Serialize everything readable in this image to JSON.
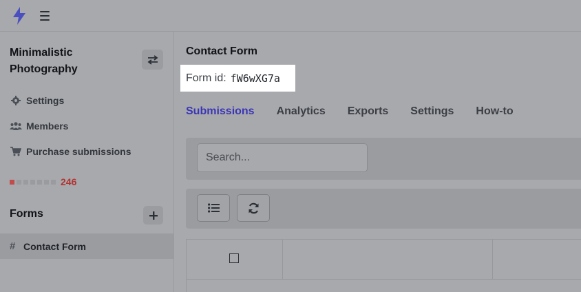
{
  "sidebar": {
    "project_name": "Minimalistic Photography",
    "nav": [
      {
        "label": "Settings",
        "icon": "gear-icon"
      },
      {
        "label": "Members",
        "icon": "users-icon"
      },
      {
        "label": "Purchase submissions",
        "icon": "cart-icon"
      }
    ],
    "usage": {
      "count": "246",
      "filled_segments": 1,
      "total_segments": 7
    },
    "forms_heading": "Forms",
    "forms": [
      {
        "label": "Contact Form",
        "icon": "hash-icon"
      }
    ]
  },
  "main": {
    "title": "Contact Form",
    "form_id_label": "Form id:",
    "form_id_value": "fW6wXG7a",
    "tabs": [
      {
        "label": "Submissions",
        "active": true
      },
      {
        "label": "Analytics",
        "active": false
      },
      {
        "label": "Exports",
        "active": false
      },
      {
        "label": "Settings",
        "active": false
      },
      {
        "label": "How-to",
        "active": false
      }
    ],
    "search": {
      "placeholder": "Search..."
    }
  },
  "colors": {
    "accent": "#3a36b7",
    "usage_alert": "#b23333",
    "overlay": "#a8a9ac",
    "highlight": "#ffffff"
  }
}
